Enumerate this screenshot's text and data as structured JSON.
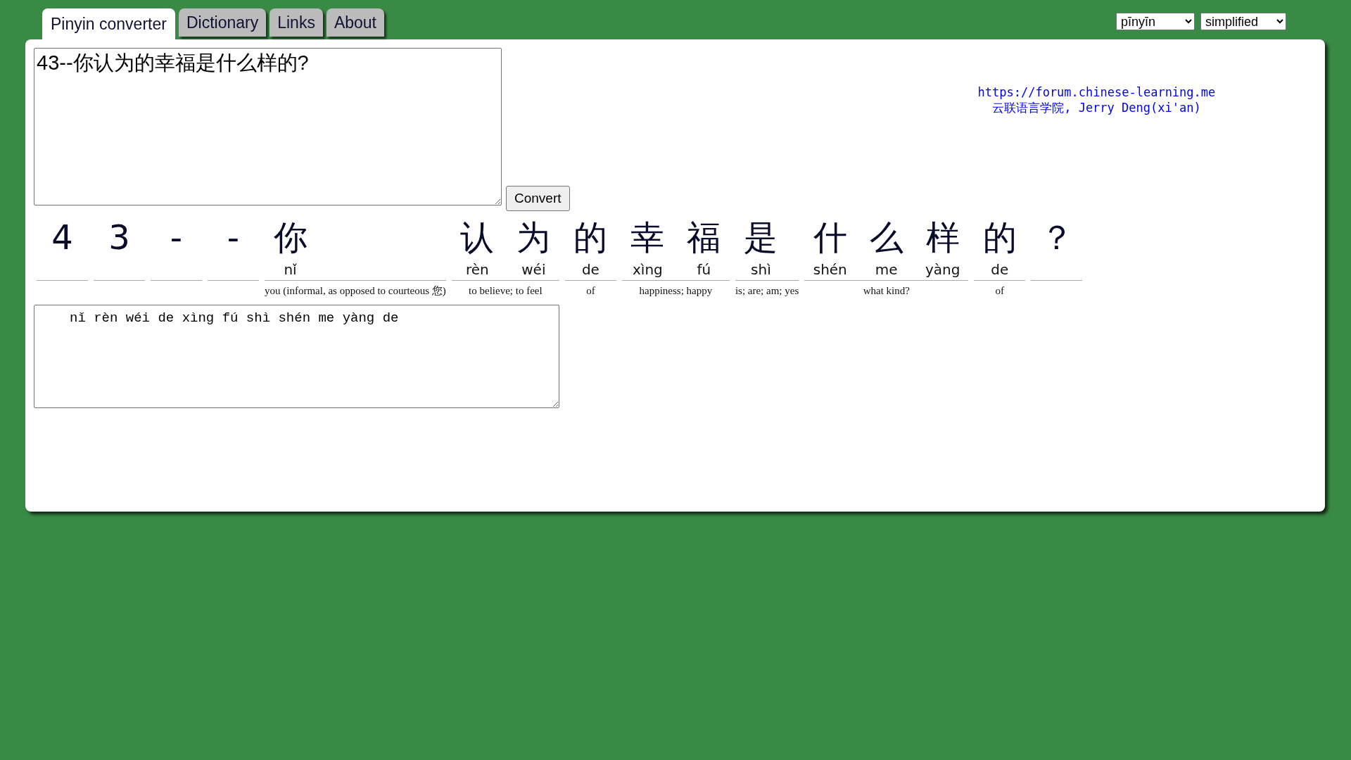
{
  "tabs": [
    {
      "label": "Pinyin converter",
      "selected": true
    },
    {
      "label": "Dictionary",
      "selected": false
    },
    {
      "label": "Links",
      "selected": false
    },
    {
      "label": "About",
      "selected": false
    }
  ],
  "selects": [
    {
      "value": "pīnyīn"
    },
    {
      "value": "simplified"
    }
  ],
  "input": {
    "value": "43--你认为的幸福是什么样的?"
  },
  "convert_button": "Convert",
  "credits": {
    "link": "https://forum.chinese-learning.me",
    "author": "云联语言学院, Jerry Deng(xi'an)"
  },
  "groups": [
    {
      "chars": [
        {
          "hanzi": "4"
        }
      ]
    },
    {
      "chars": [
        {
          "hanzi": "3"
        }
      ]
    },
    {
      "chars": [
        {
          "hanzi": "-"
        }
      ]
    },
    {
      "chars": [
        {
          "hanzi": "-"
        }
      ]
    },
    {
      "chars": [
        {
          "hanzi": "你",
          "pinyin": "nǐ"
        }
      ],
      "definition": "you (informal, as opposed to courteous 您)"
    },
    {
      "chars": [
        {
          "hanzi": "认",
          "pinyin": "rèn"
        },
        {
          "hanzi": "为",
          "pinyin": "wéi"
        }
      ],
      "definition": "to believe; to feel"
    },
    {
      "chars": [
        {
          "hanzi": "的",
          "pinyin": "de"
        }
      ],
      "definition": "of"
    },
    {
      "chars": [
        {
          "hanzi": "幸",
          "pinyin": "xìng"
        },
        {
          "hanzi": "福",
          "pinyin": "fú"
        }
      ],
      "definition": "happiness; happy"
    },
    {
      "chars": [
        {
          "hanzi": "是",
          "pinyin": "shì"
        }
      ],
      "definition": "is; are; am; yes"
    },
    {
      "chars": [
        {
          "hanzi": "什",
          "pinyin": "shén"
        },
        {
          "hanzi": "么",
          "pinyin": "me"
        },
        {
          "hanzi": "样",
          "pinyin": "yàng"
        }
      ],
      "definition": "what kind?"
    },
    {
      "chars": [
        {
          "hanzi": "的",
          "pinyin": "de"
        }
      ],
      "definition": "of"
    },
    {
      "chars": [
        {
          "hanzi": "？"
        }
      ]
    }
  ],
  "output": {
    "value": "nǐ rèn wéi de xìng fú shì shén me yàng de"
  }
}
